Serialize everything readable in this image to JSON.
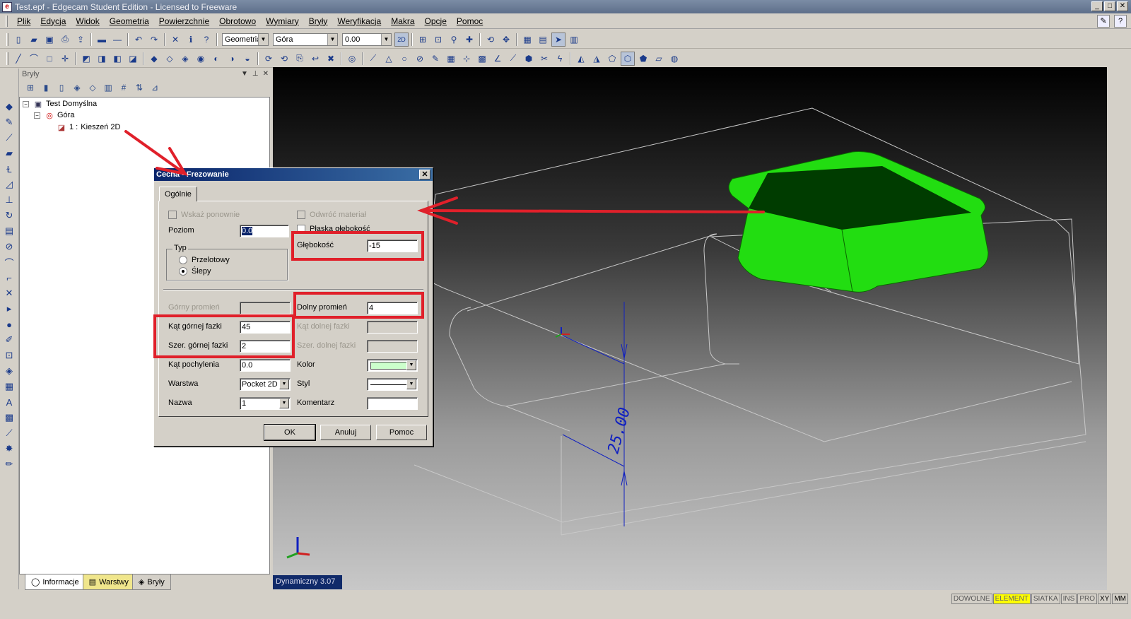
{
  "window": {
    "title": "Test.epf - Edgecam Student Edition - Licensed to Freeware",
    "app_icon": "e"
  },
  "menu": [
    "Plik",
    "Edycja",
    "Widok",
    "Geometria",
    "Powierzchnie",
    "Obrotowo",
    "Wymiary",
    "Bryły",
    "Weryfikacja",
    "Makra",
    "Opcje",
    "Pomoc"
  ],
  "toolbar": {
    "mode_combo": "Geometria",
    "view_combo": "Góra",
    "z_combo": "0.00",
    "toggle_2d": "2D"
  },
  "panel": {
    "title": "Bryły",
    "tree": {
      "root": "Test Domyślna",
      "child": "Góra",
      "feature_index": "1 :",
      "feature": "Kieszeń 2D"
    },
    "tabs": [
      "Informacje",
      "Warstwy",
      "Bryły"
    ]
  },
  "viewport": {
    "status": "Dynamiczny 3.07",
    "dimension_text": "25.00",
    "colors": {
      "pocket": "#22dd11",
      "wire": "#c8c8c8",
      "dimension": "#1020c0",
      "annotation": "#e0202a"
    }
  },
  "statusbar": [
    "DOWOLNE",
    "ELEMENT",
    "SIATKA",
    "INS",
    "PRO",
    "XY",
    "MM"
  ],
  "dialog": {
    "title": "Cecha - Frezowanie",
    "tab": "Ogólnie",
    "wskaz_ponownie": "Wskaż ponownie",
    "odwroc_material": "Odwróć materiał",
    "plaska_glebokosc": "Płaska głębokość",
    "poziom_label": "Poziom",
    "poziom_value": "0.0",
    "glebokosc_label": "Głębokość",
    "glebokosc_value": "-15",
    "typ_label": "Typ",
    "przelotowy": "Przelotowy",
    "slepy": "Ślepy",
    "gorny_promien_label": "Górny promień",
    "dolny_promien_label": "Dolny promień",
    "dolny_promien_value": "4",
    "kat_gornej_fazki_label": "Kąt górnej fazki",
    "kat_gornej_fazki_value": "45",
    "kat_dolnej_fazki_label": "Kąt dolnej fazki",
    "szer_gornej_fazki_label": "Szer. górnej fazki",
    "szer_gornej_fazki_value": "2",
    "szer_dolnej_fazki_label": "Szer. dolnej fazki",
    "kat_pochylenia_label": "Kąt pochylenia",
    "kat_pochylenia_value": "0.0",
    "kolor_label": "Kolor",
    "warstwa_label": "Warstwa",
    "warstwa_value": "Pocket 2D",
    "styl_label": "Styl",
    "nazwa_label": "Nazwa",
    "nazwa_value": "1",
    "komentarz_label": "Komentarz",
    "komentarz_value": "",
    "ok": "OK",
    "anuluj": "Anuluj",
    "pomoc": "Pomoc"
  }
}
